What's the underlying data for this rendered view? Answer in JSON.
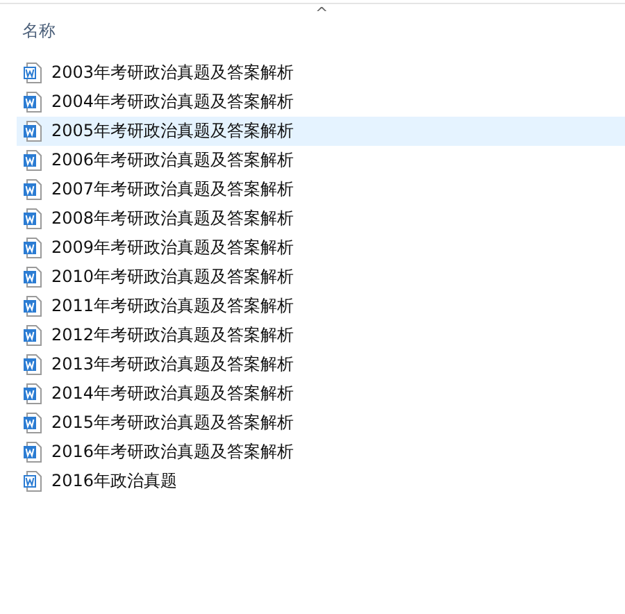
{
  "header": {
    "column_label": "名称",
    "sort_indicator": "^"
  },
  "files": [
    {
      "name": "2003年考研政治真题及答案解析",
      "kind": "doc",
      "selected": false
    },
    {
      "name": "2004年考研政治真题及答案解析",
      "kind": "docx",
      "selected": false
    },
    {
      "name": "2005年考研政治真题及答案解析",
      "kind": "docx",
      "selected": true
    },
    {
      "name": "2006年考研政治真题及答案解析",
      "kind": "docx",
      "selected": false
    },
    {
      "name": "2007年考研政治真题及答案解析",
      "kind": "docx",
      "selected": false
    },
    {
      "name": "2008年考研政治真题及答案解析",
      "kind": "docx",
      "selected": false
    },
    {
      "name": "2009年考研政治真题及答案解析",
      "kind": "docx",
      "selected": false
    },
    {
      "name": "2010年考研政治真题及答案解析",
      "kind": "docx",
      "selected": false
    },
    {
      "name": "2011年考研政治真题及答案解析",
      "kind": "docx",
      "selected": false
    },
    {
      "name": "2012年考研政治真题及答案解析",
      "kind": "docx",
      "selected": false
    },
    {
      "name": "2013年考研政治真题及答案解析",
      "kind": "docx",
      "selected": false
    },
    {
      "name": "2014年考研政治真题及答案解析",
      "kind": "docx",
      "selected": false
    },
    {
      "name": "2015年考研政治真题及答案解析",
      "kind": "docx",
      "selected": false
    },
    {
      "name": "2016年考研政治真题及答案解析",
      "kind": "docx",
      "selected": false
    },
    {
      "name": "2016年政治真题",
      "kind": "doc",
      "selected": false
    }
  ]
}
